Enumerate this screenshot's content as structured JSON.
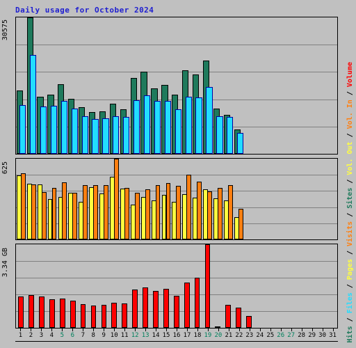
{
  "title": "Daily usage for October 2024",
  "axis_labels": {
    "hits_max": "30575",
    "sites_max": "625",
    "volume_max": "3.34 GB"
  },
  "legend": {
    "text": "Volume / Vol. In / Vol. Out / Sites / Visits / Pages / Files / Hits",
    "entries": [
      {
        "label": "Hits",
        "color": "#1f7a5c"
      },
      {
        "label": "Files",
        "color": "#22ddff"
      },
      {
        "label": "Pages",
        "color": "#ffff40"
      },
      {
        "label": "Visits",
        "color": "#ff7f10"
      },
      {
        "label": "Sites",
        "color": "#1f7a5c"
      },
      {
        "label": "Vol. Out",
        "color": "#ffff40"
      },
      {
        "label": "Vol. In",
        "color": "#ff7f10"
      },
      {
        "label": "Volume",
        "color": "#ff0000"
      }
    ]
  },
  "colors": {
    "background": "#c0c0c0",
    "title": "#2020d0",
    "grid": "#808080",
    "weekend": "#00805c",
    "hits": "#1f7a5c",
    "files": "#22ddff",
    "pages": "#ffff40",
    "visits": "#ff7f10",
    "volume": "#ff0000"
  },
  "days": [
    "1",
    "2",
    "3",
    "4",
    "5",
    "6",
    "7",
    "8",
    "9",
    "10",
    "11",
    "12",
    "13",
    "14",
    "15",
    "16",
    "17",
    "18",
    "19",
    "20",
    "21",
    "22",
    "23",
    "24",
    "25",
    "26",
    "27",
    "28",
    "29",
    "30",
    "31"
  ],
  "weekend_days": [
    "5",
    "6",
    "12",
    "13",
    "19",
    "20",
    "26",
    "27"
  ],
  "chart_data": [
    {
      "type": "bar",
      "title": "Daily usage for October 2024",
      "panel": "hits-files",
      "xlabel": "",
      "ylabel": "Hits / Files",
      "ylim": [
        0,
        30575
      ],
      "grid": true,
      "gridlines": 5,
      "categories": [
        "1",
        "2",
        "3",
        "4",
        "5",
        "6",
        "7",
        "8",
        "9",
        "10",
        "11",
        "12",
        "13",
        "14",
        "15",
        "16",
        "17",
        "18",
        "19",
        "20",
        "21",
        "22",
        "23",
        "24",
        "25",
        "26",
        "27",
        "28",
        "29",
        "30",
        "31"
      ],
      "series": [
        {
          "name": "Hits",
          "color": "#1f7a5c",
          "values": [
            14250,
            30575,
            12750,
            13250,
            15600,
            12350,
            10450,
            9400,
            9550,
            11200,
            10050,
            17050,
            18350,
            14650,
            15450,
            13300,
            18650,
            17800,
            20850,
            10150,
            8800,
            5400,
            0,
            0,
            0,
            0,
            0,
            0,
            0,
            0,
            0
          ]
        },
        {
          "name": "Files",
          "color": "#22ddff",
          "values": [
            10900,
            22150,
            10650,
            10700,
            11900,
            10200,
            8350,
            7850,
            7900,
            8400,
            8250,
            11950,
            13050,
            11900,
            11900,
            9950,
            12800,
            12650,
            14900,
            8500,
            8250,
            4700,
            0,
            0,
            0,
            0,
            0,
            0,
            0,
            0,
            0
          ]
        }
      ]
    },
    {
      "type": "bar",
      "panel": "sites-visits-pages",
      "xlabel": "",
      "ylabel": "Sites / Visits / Pages",
      "ylim": [
        0,
        625
      ],
      "grid": true,
      "gridlines": 5,
      "categories": [
        "1",
        "2",
        "3",
        "4",
        "5",
        "6",
        "7",
        "8",
        "9",
        "10",
        "11",
        "12",
        "13",
        "14",
        "15",
        "16",
        "17",
        "18",
        "19",
        "20",
        "21",
        "22",
        "23",
        "24",
        "25",
        "26",
        "27",
        "28",
        "29",
        "30",
        "31"
      ],
      "series": [
        {
          "name": "Pages",
          "color": "#ffff40",
          "values": [
            497,
            430,
            428,
            313,
            330,
            360,
            292,
            405,
            355,
            485,
            395,
            270,
            328,
            300,
            345,
            290,
            350,
            325,
            390,
            320,
            300,
            175,
            0,
            0,
            0,
            0,
            0,
            0,
            0,
            0,
            0
          ]
        },
        {
          "name": "Visits",
          "color": "#ff7f10",
          "values": [
            512,
            425,
            368,
            400,
            443,
            360,
            420,
            418,
            423,
            625,
            400,
            360,
            388,
            418,
            435,
            415,
            500,
            445,
            373,
            400,
            420,
            235,
            0,
            0,
            0,
            0,
            0,
            0,
            0,
            0,
            0
          ]
        }
      ]
    },
    {
      "type": "bar",
      "panel": "volume",
      "xlabel": "",
      "ylabel": "Volume",
      "ylim": [
        0,
        3.34
      ],
      "units": "GB",
      "grid": true,
      "gridlines": 5,
      "categories": [
        "1",
        "2",
        "3",
        "4",
        "5",
        "6",
        "7",
        "8",
        "9",
        "10",
        "11",
        "12",
        "13",
        "14",
        "15",
        "16",
        "17",
        "18",
        "19",
        "20",
        "21",
        "22",
        "23",
        "24",
        "25",
        "26",
        "27",
        "28",
        "29",
        "30",
        "31"
      ],
      "series": [
        {
          "name": "Volume",
          "color": "#ff0000",
          "values": [
            1.25,
            1.3,
            1.24,
            1.15,
            1.18,
            1.08,
            0.95,
            0.88,
            0.92,
            1.0,
            0.98,
            1.52,
            1.62,
            1.48,
            1.55,
            1.28,
            1.8,
            2.0,
            3.34,
            0.04,
            0.92,
            0.82,
            0.48,
            0,
            0,
            0,
            0,
            0,
            0,
            0,
            0
          ]
        }
      ]
    }
  ]
}
